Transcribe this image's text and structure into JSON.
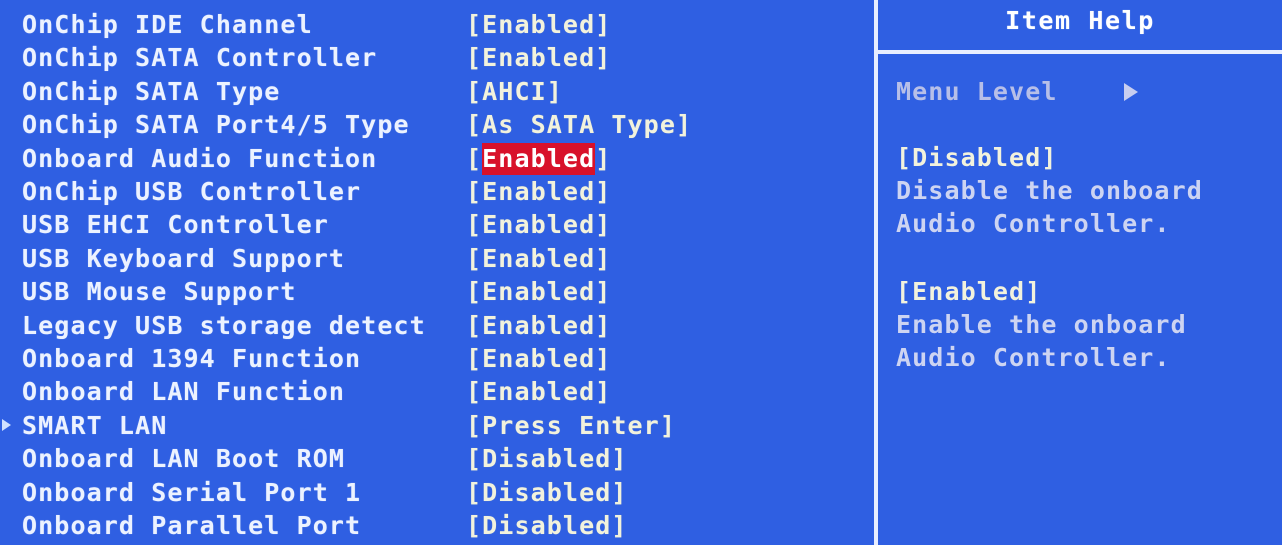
{
  "screen": {
    "background_color": "#2f5fe2",
    "divider_color": "#e8eeff",
    "label_color": "#ecf2ff",
    "value_color": "#f2f2dd",
    "highlight_bg_color": "#d8112a",
    "highlight_fg_color": "#ffffff",
    "help_dim_color": "#cdd4f2"
  },
  "settings": {
    "rows": [
      {
        "label": "OnChip IDE Channel",
        "value": "Enabled",
        "selected": false,
        "submenu": false
      },
      {
        "label": "OnChip SATA Controller",
        "value": "Enabled",
        "selected": false,
        "submenu": false
      },
      {
        "label": "OnChip SATA Type",
        "value": "AHCI",
        "selected": false,
        "submenu": false
      },
      {
        "label": "OnChip SATA Port4/5 Type",
        "value": "As SATA Type",
        "selected": false,
        "submenu": false
      },
      {
        "label": "Onboard Audio Function",
        "value": "Enabled",
        "selected": true,
        "submenu": false
      },
      {
        "label": "OnChip USB Controller",
        "value": "Enabled",
        "selected": false,
        "submenu": false
      },
      {
        "label": "USB EHCI Controller",
        "value": "Enabled",
        "selected": false,
        "submenu": false
      },
      {
        "label": "USB Keyboard Support",
        "value": "Enabled",
        "selected": false,
        "submenu": false
      },
      {
        "label": "USB Mouse Support",
        "value": "Enabled",
        "selected": false,
        "submenu": false
      },
      {
        "label": "Legacy USB storage detect",
        "value": "Enabled",
        "selected": false,
        "submenu": false
      },
      {
        "label": "Onboard 1394 Function",
        "value": "Enabled",
        "selected": false,
        "submenu": false
      },
      {
        "label": "Onboard LAN Function",
        "value": "Enabled",
        "selected": false,
        "submenu": false
      },
      {
        "label": "SMART LAN",
        "value": "Press Enter",
        "selected": false,
        "submenu": true
      },
      {
        "label": "Onboard LAN Boot ROM",
        "value": "Disabled",
        "selected": false,
        "submenu": false
      },
      {
        "label": "Onboard Serial Port 1",
        "value": "Disabled",
        "selected": false,
        "submenu": false
      },
      {
        "label": "Onboard Parallel Port",
        "value": "Disabled",
        "selected": false,
        "submenu": false
      }
    ]
  },
  "help": {
    "title": "Item Help",
    "menu_level_label": "Menu Level",
    "menu_level_arrow_icon": "triangle-right-icon",
    "options": [
      {
        "option": "[Disabled]",
        "lines": [
          "Disable the onboard",
          "Audio Controller."
        ]
      },
      {
        "option": "[Enabled]",
        "lines": [
          "Enable the onboard",
          "Audio Controller."
        ]
      }
    ]
  }
}
